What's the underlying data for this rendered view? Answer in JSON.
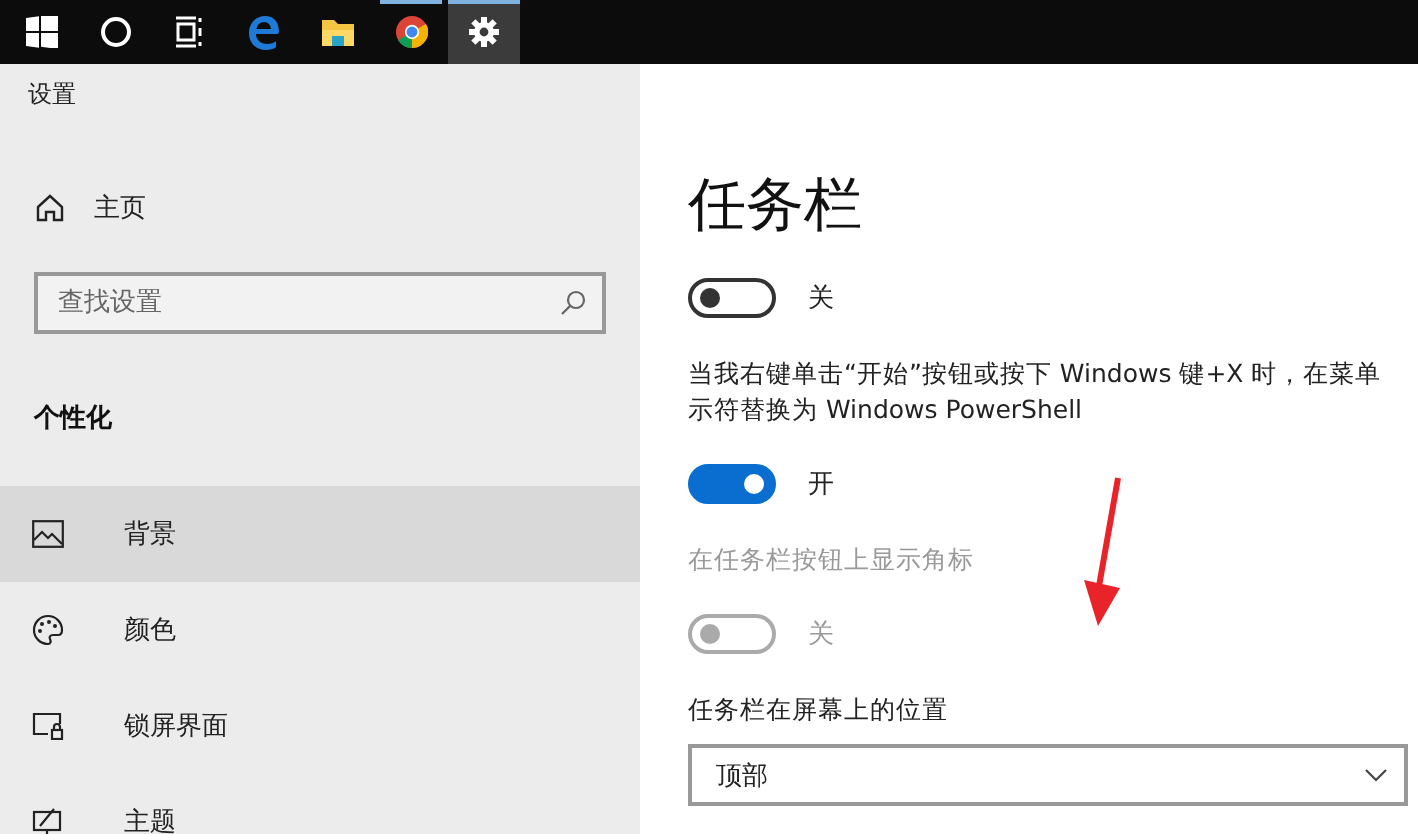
{
  "taskbar": {
    "apps": [
      {
        "kind": "windows",
        "running": false,
        "selected": false
      },
      {
        "kind": "cortana",
        "running": false,
        "selected": false
      },
      {
        "kind": "taskview",
        "running": false,
        "selected": false
      },
      {
        "kind": "edge",
        "running": false,
        "selected": false
      },
      {
        "kind": "explorer",
        "running": false,
        "selected": false
      },
      {
        "kind": "chrome",
        "running": true,
        "selected": false
      },
      {
        "kind": "settings",
        "running": true,
        "selected": true
      }
    ]
  },
  "sidebar": {
    "title": "设置",
    "home": "主页",
    "search": {
      "placeholder": "查找设置"
    },
    "section": "个性化",
    "items": [
      {
        "kind": "background",
        "label": "背景",
        "selected": true
      },
      {
        "kind": "colors",
        "label": "颜色",
        "selected": false
      },
      {
        "kind": "lockscreen",
        "label": "锁屏界面",
        "selected": false
      },
      {
        "kind": "themes",
        "label": "主题",
        "selected": false
      }
    ]
  },
  "main": {
    "title": "任务栏",
    "settings": [
      {
        "kind": "toggle",
        "on": false,
        "disabled": false,
        "label": "关"
      },
      {
        "kind": "caption",
        "disabled": false,
        "lines": [
          "当我右键单击“开始”按钮或按下 Windows 键+X 时，在菜单",
          "示符替换为 Windows PowerShell"
        ]
      },
      {
        "kind": "toggle",
        "on": true,
        "disabled": false,
        "label": "开"
      },
      {
        "kind": "caption",
        "disabled": true,
        "lines": [
          "在任务栏按钮上显示角标"
        ]
      },
      {
        "kind": "toggle",
        "on": false,
        "disabled": true,
        "label": "关"
      },
      {
        "kind": "caption",
        "disabled": false,
        "lines": [
          "任务栏在屏幕上的位置"
        ]
      },
      {
        "kind": "select",
        "value": "顶部"
      }
    ]
  }
}
